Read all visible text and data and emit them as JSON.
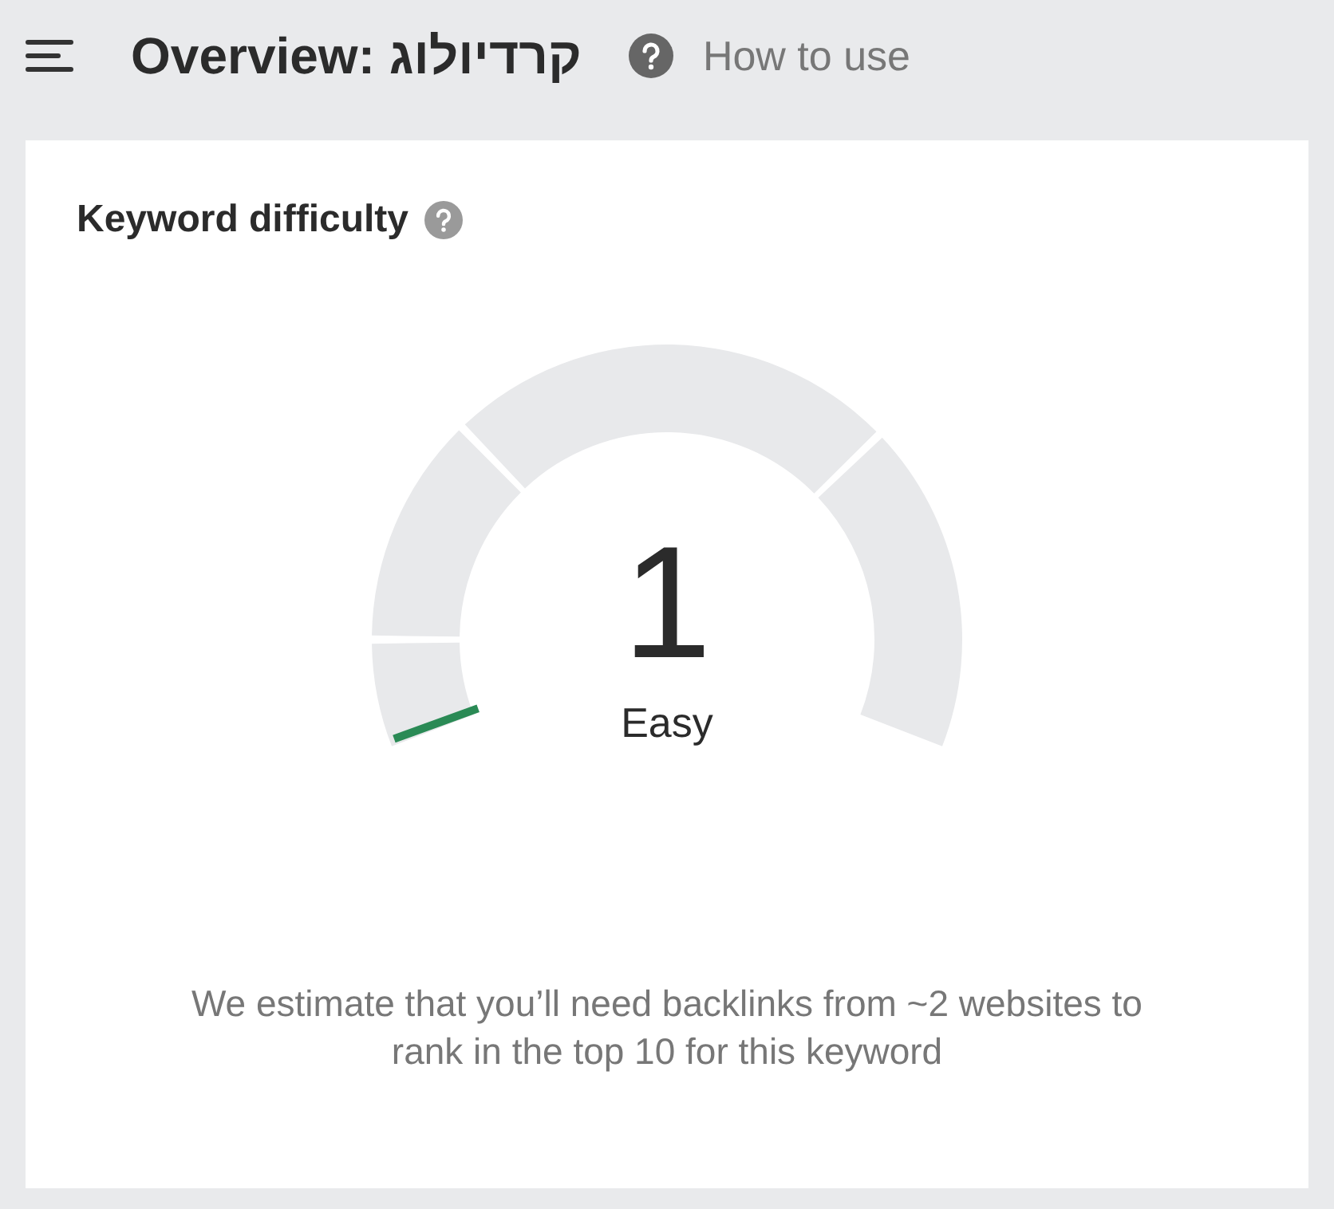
{
  "header": {
    "title": "Overview: קרדיולוג",
    "help_link": "How to use"
  },
  "card": {
    "title": "Keyword difficulty",
    "gauge": {
      "value": "1",
      "rating": "Easy"
    },
    "description": "We estimate that you’ll need backlinks from ~2 websites to rank in the top 10 for this keyword"
  }
}
